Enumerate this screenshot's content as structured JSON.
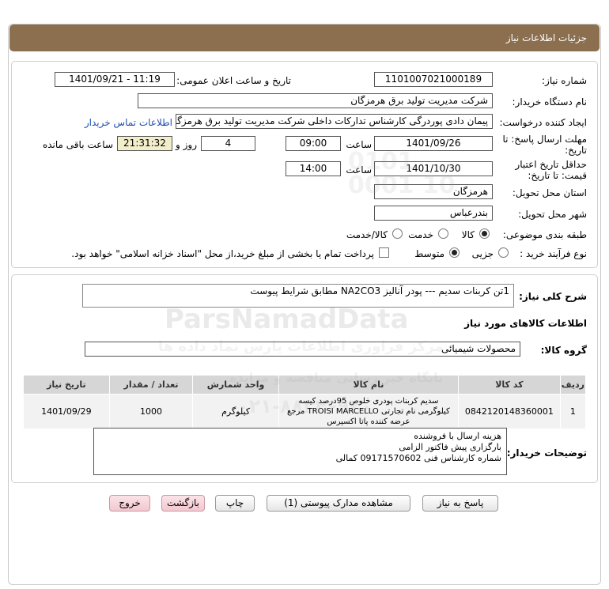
{
  "header": {
    "title": "جزئیات اطلاعات نیاز"
  },
  "form": {
    "need_number": {
      "label": "شماره نیاز:",
      "value": "1101007021000189"
    },
    "announce_datetime": {
      "label": "تاریخ و ساعت اعلان عمومی:",
      "value": "1401/09/21 - 11:19"
    },
    "buyer_org": {
      "label": "نام دستگاه خریدار:",
      "value": "شرکت مدیریت تولید برق هرمزگان"
    },
    "requester": {
      "label": "ایجاد کننده درخواست:",
      "value": "پیمان دادی پوردرگی کارشناس تدارکات داخلی شرکت مدیریت تولید برق هرمزگا"
    },
    "contact_link": "اطلاعات تماس خریدار",
    "deadline": {
      "label_line1": "مهلت ارسال پاسخ: تا",
      "label_line2": "تاریخ:",
      "date": "1401/09/26",
      "time_label": "ساعت",
      "time": "09:00",
      "days": "4",
      "days_label": "روز و",
      "remaining": "21:31:32",
      "remaining_label": "ساعت باقی مانده"
    },
    "validity": {
      "label_line1": "حداقل تاریخ اعتبار",
      "label_line2": "قیمت: تا تاریخ:",
      "date": "1401/10/30",
      "time_label": "ساعت",
      "time": "14:00"
    },
    "province": {
      "label": "استان محل تحویل:",
      "value": "هرمزگان"
    },
    "city": {
      "label": "شهر محل تحویل:",
      "value": "بندرعباس"
    },
    "category": {
      "label": "طبقه بندی موضوعی:",
      "options": [
        "کالا",
        "خدمت",
        "کالا/خدمت"
      ],
      "selected": "کالا"
    },
    "purchase_type": {
      "label": "نوع فرآیند خرید :",
      "options": [
        "جزیی",
        "متوسط"
      ],
      "selected": "متوسط",
      "checkbox_label": "پرداخت تمام یا بخشی از مبلغ خرید،از محل \"اسناد خزانه اسلامی\" خواهد بود."
    }
  },
  "details": {
    "summary_label": "شرح کلی نیاز:",
    "summary": "1تن کربنات سدیم --- پودر آنالیز NA2CO3 مطابق شرایط پیوست",
    "goods_section_title": "اطلاعات کالاهای مورد نیاز",
    "goods_group_label": "گروه کالا:",
    "goods_group": "محصولات شیمیائی"
  },
  "table": {
    "headers": [
      "ردیف",
      "کد کالا",
      "نام کالا",
      "واحد شمارش",
      "تعداد / مقدار",
      "تاریخ نیاز"
    ],
    "rows": [
      {
        "row": "1",
        "code": "0842120148360001",
        "name": "سدیم کربنات پودری خلوص 95درصد کیسه کیلوگرمی نام تجارتی TROISI MARCELLO مرجع عرضه کننده پاتا اکسپرس",
        "unit": "کیلوگرم",
        "qty": "1000",
        "date": "1401/09/29"
      }
    ]
  },
  "buyer_notes": {
    "label": "توضیحات خریدار:",
    "lines": [
      "هزینه ارسال با فروشنده",
      "بارگزاری پیش فاکتور الزامی",
      "شماره کارشناس فنی 09171570602 کمالی"
    ]
  },
  "buttons": {
    "reply": "پاسخ به نیاز",
    "attachments": "مشاهده مدارک پیوستی (1)",
    "print": "چاپ",
    "back": "بازگشت",
    "exit": "خروج"
  },
  "watermark": {
    "brand": "ParsNamadData",
    "tagline1": "مرکز فراوری اطلاعات پارس نماد داده ها",
    "tagline2": "پایگاه خبر رسانی مناقصه و مزایده",
    "phone": "۰۲۱-۸۸۳۴۶۹۴۰",
    "number": "0101 0001 10"
  },
  "colors": {
    "titlebar": "#8b6f4e",
    "link": "#1f4fb3",
    "remaining_bg": "#f2eecb",
    "exit_button_bg": "#f3c7cf"
  }
}
